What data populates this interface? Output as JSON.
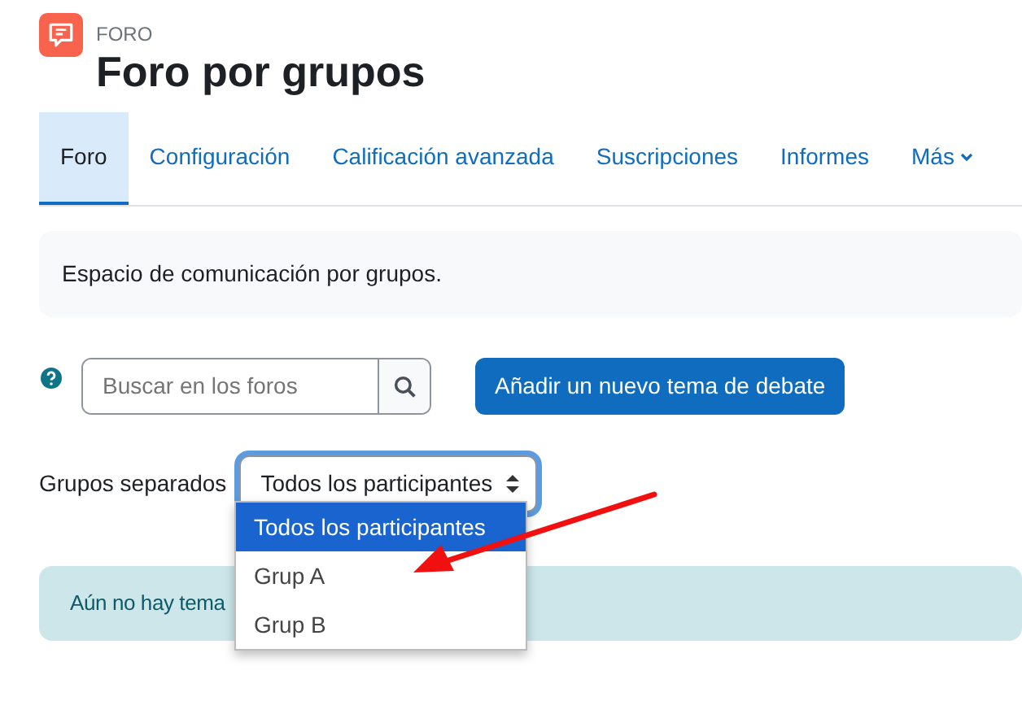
{
  "header": {
    "module_label": "FORO",
    "title": "Foro por grupos"
  },
  "tabs": [
    {
      "label": "Foro",
      "selected": true
    },
    {
      "label": "Configuración",
      "selected": false
    },
    {
      "label": "Calificación avanzada",
      "selected": false
    },
    {
      "label": "Suscripciones",
      "selected": false
    },
    {
      "label": "Informes",
      "selected": false
    },
    {
      "label": "Más",
      "selected": false,
      "kind": "dropdown"
    }
  ],
  "description": "Espacio de comunicación por grupos.",
  "search": {
    "placeholder": "Buscar en los foros"
  },
  "add_button": "Añadir un nuevo tema de debate",
  "group_filter": {
    "label": "Grupos separados",
    "value": "Todos los participantes",
    "expanded": true,
    "options": [
      {
        "label": "Todos los participantes",
        "selected": true
      },
      {
        "label": "Grup A",
        "selected": false
      },
      {
        "label": "Grup B",
        "selected": false
      }
    ]
  },
  "alert": "Aún no hay tema"
}
